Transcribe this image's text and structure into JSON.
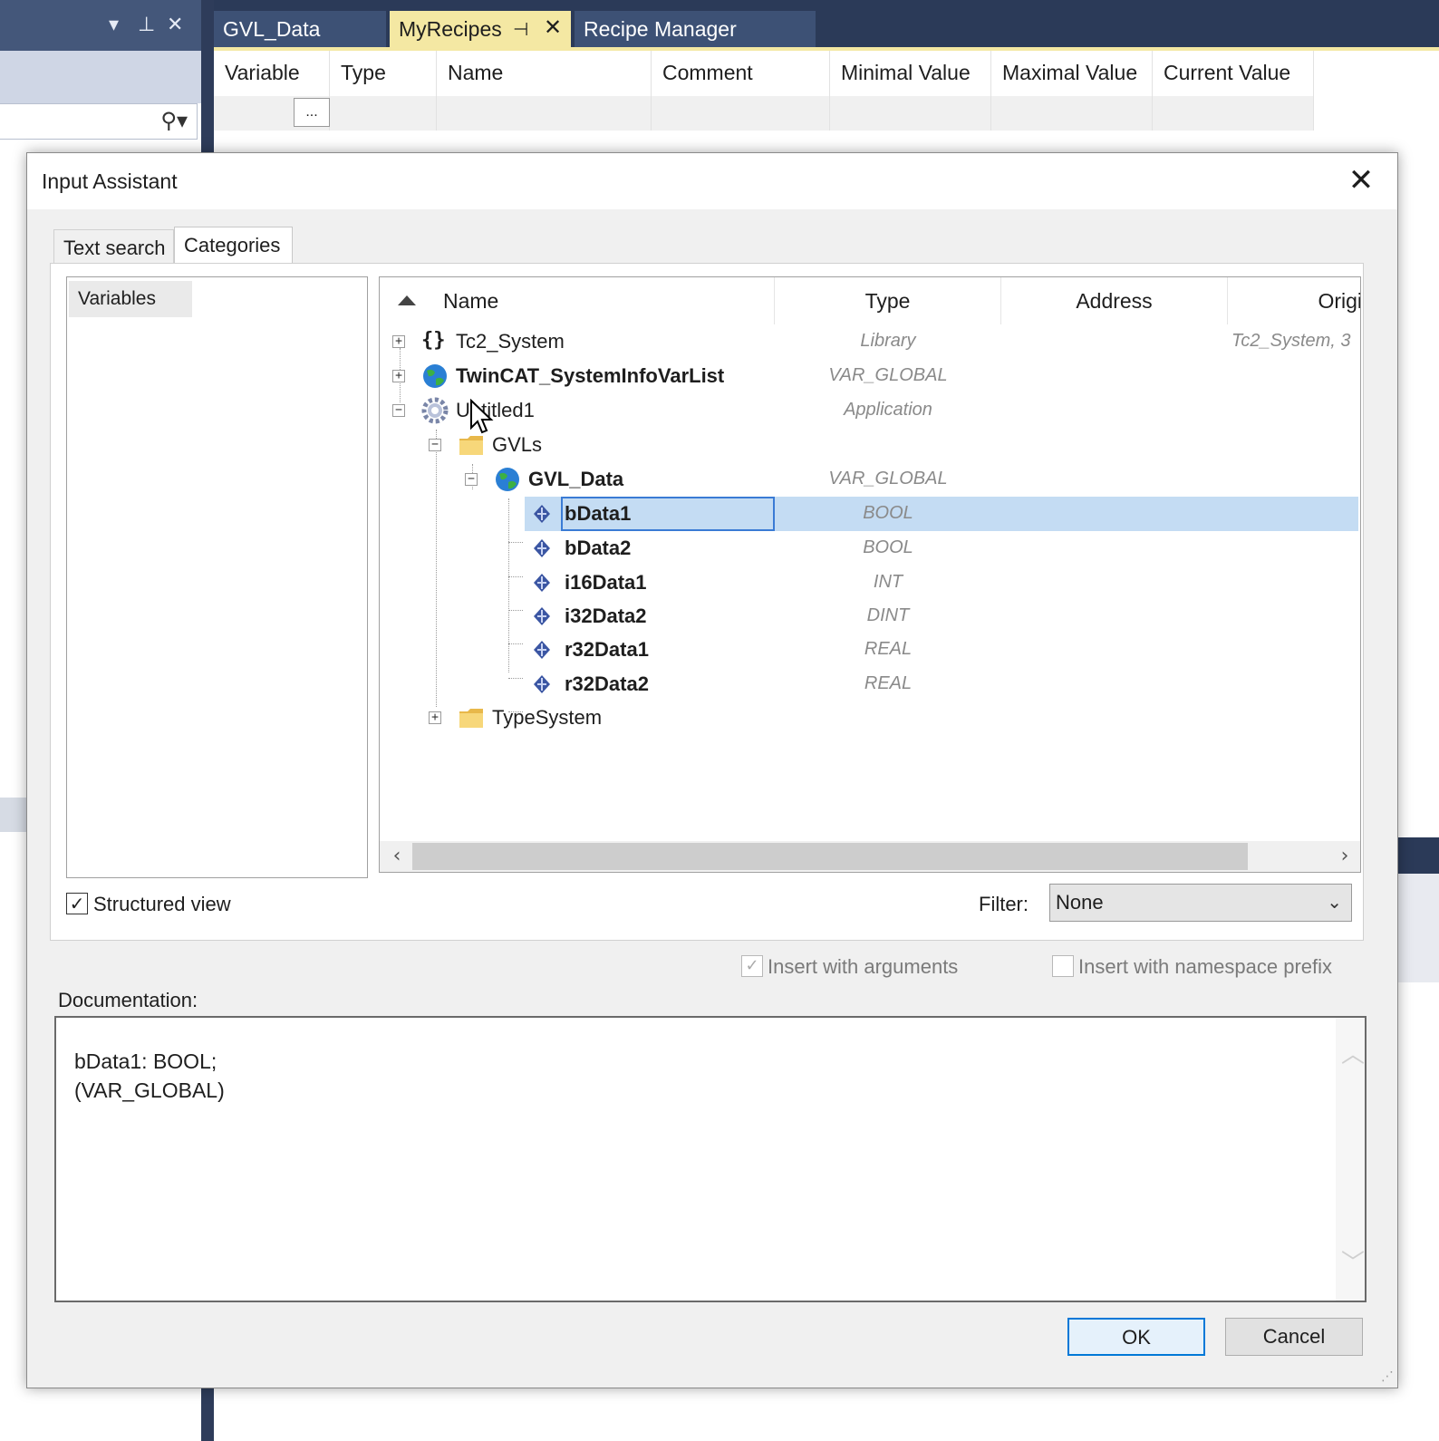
{
  "ide": {
    "tabs": [
      {
        "label": "GVL_Data"
      },
      {
        "label": "MyRecipes",
        "pin_icon": "pin-icon",
        "close_icon": "close-icon"
      },
      {
        "label": "Recipe Manager"
      }
    ],
    "recipe_table": {
      "columns": [
        "Variable",
        "Type",
        "Name",
        "Comment",
        "Minimal Value",
        "Maximal Value",
        "Current Value"
      ],
      "ellipsis_button": "..."
    }
  },
  "dialog": {
    "title": "Input Assistant",
    "tabs": [
      "Text search",
      "Categories"
    ],
    "active_tab": "Categories",
    "categories": [
      "Variables"
    ],
    "tree": {
      "columns": [
        "Name",
        "Type",
        "Address",
        "Origi"
      ],
      "rows": [
        {
          "name": "Tc2_System",
          "type": "Library",
          "origin": "Tc2_System, 3",
          "icon": "braces-icon"
        },
        {
          "name": "TwinCAT_SystemInfoVarList",
          "type": "VAR_GLOBAL",
          "origin": "",
          "icon": "globe-icon"
        },
        {
          "name": "Untitled1",
          "type": "Application",
          "origin": "",
          "icon": "gear-icon"
        },
        {
          "name": "GVLs",
          "type": "",
          "origin": "",
          "icon": "folder-icon"
        },
        {
          "name": "GVL_Data",
          "type": "VAR_GLOBAL",
          "origin": "",
          "icon": "globe-icon"
        },
        {
          "name": "bData1",
          "type": "BOOL",
          "origin": "",
          "icon": "variable-icon",
          "selected": true
        },
        {
          "name": "bData2",
          "type": "BOOL",
          "origin": "",
          "icon": "variable-icon"
        },
        {
          "name": "i16Data1",
          "type": "INT",
          "origin": "",
          "icon": "variable-icon"
        },
        {
          "name": "i32Data2",
          "type": "DINT",
          "origin": "",
          "icon": "variable-icon"
        },
        {
          "name": "r32Data1",
          "type": "REAL",
          "origin": "",
          "icon": "variable-icon"
        },
        {
          "name": "r32Data2",
          "type": "REAL",
          "origin": "",
          "icon": "variable-icon"
        },
        {
          "name": "TypeSystem",
          "type": "",
          "origin": "",
          "icon": "folder-icon"
        }
      ]
    },
    "structured_view": {
      "label": "Structured view",
      "checked": true
    },
    "filter": {
      "label": "Filter:",
      "value": "None"
    },
    "insert_with_arguments": {
      "label": "Insert with arguments",
      "checked": true,
      "enabled": false
    },
    "insert_with_namespace_prefix": {
      "label": "Insert with namespace prefix",
      "checked": false,
      "enabled": false
    },
    "documentation": {
      "label": "Documentation:",
      "text": "bData1: BOOL;\n(VAR_GLOBAL)"
    },
    "ok_label": "OK",
    "cancel_label": "Cancel"
  },
  "colors": {
    "ide_dark": "#2b3a58",
    "active_tab": "#f4e8a3",
    "selection": "#c4dcf3",
    "focus_blue": "#0078d7"
  }
}
